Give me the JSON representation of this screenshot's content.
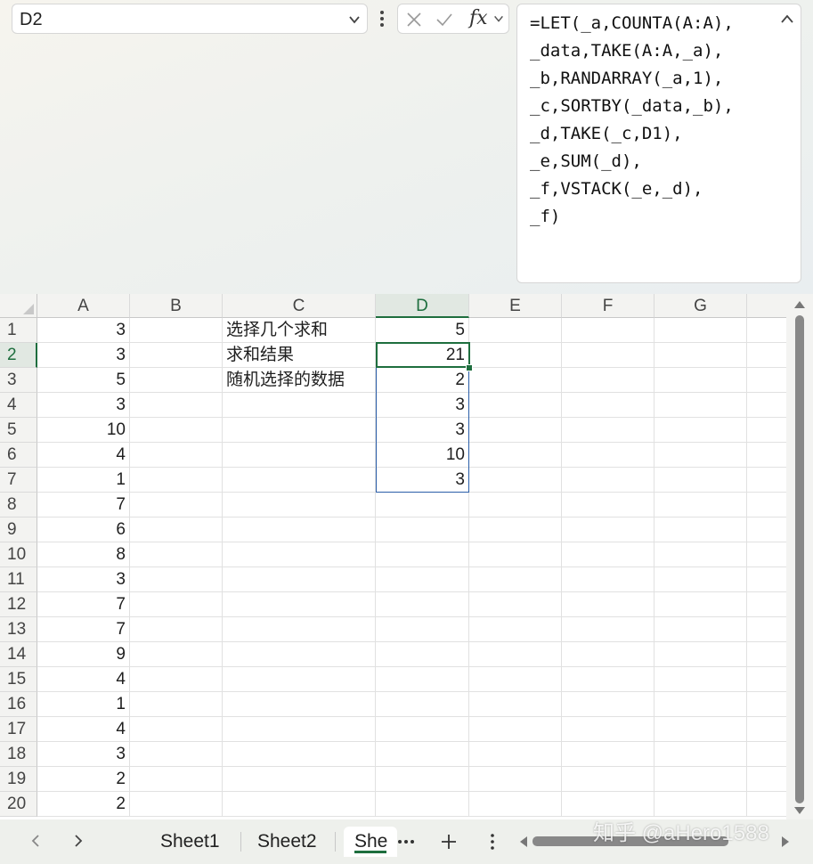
{
  "namebox": {
    "value": "D2"
  },
  "formula_bar": {
    "fx_label": "fx",
    "lines": [
      "=LET(_a,COUNTA(A:A),",
      "_data,TAKE(A:A,_a),",
      "_b,RANDARRAY(_a,1),",
      "_c,SORTBY(_data,_b),",
      "_d,TAKE(_c,D1),",
      "_e,SUM(_d),",
      "_f,VSTACK(_e,_d),",
      "_f)"
    ]
  },
  "columns": [
    "A",
    "B",
    "C",
    "D",
    "E",
    "F",
    "G"
  ],
  "rows": [
    "1",
    "2",
    "3",
    "4",
    "5",
    "6",
    "7",
    "8",
    "9",
    "10",
    "11",
    "12",
    "13",
    "14",
    "15",
    "16",
    "17",
    "18",
    "19",
    "20"
  ],
  "col_a": [
    "3",
    "3",
    "5",
    "3",
    "10",
    "4",
    "1",
    "7",
    "6",
    "8",
    "3",
    "7",
    "7",
    "9",
    "4",
    "1",
    "4",
    "3",
    "2",
    "2"
  ],
  "col_c": [
    "选择几个求和",
    "求和结果",
    "随机选择的数据"
  ],
  "col_d": [
    "5",
    "21",
    "2",
    "3",
    "3",
    "10",
    "3"
  ],
  "tabs": {
    "sheet1": "Sheet1",
    "sheet2": "Sheet2",
    "sheet3": "She"
  },
  "watermark": "知乎 @aHero1588",
  "colors": {
    "accent": "#1e6e3e",
    "range_border": "#2b5ea8"
  }
}
